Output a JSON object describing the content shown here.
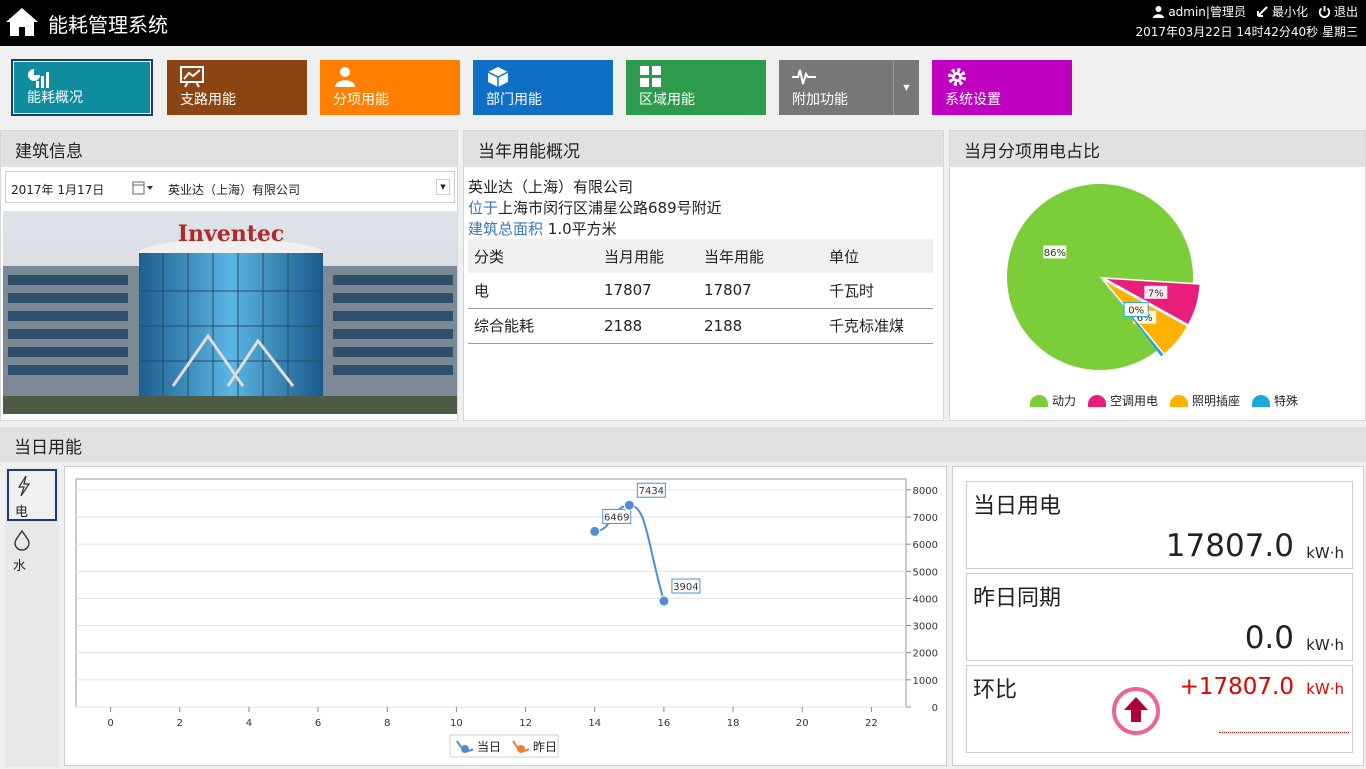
{
  "app": {
    "title": "能耗管理系统"
  },
  "user": {
    "name": "admin|管理员",
    "minimize": "最小化",
    "logout": "退出",
    "datetime": "2017年03月22日 14时42分40秒 星期三"
  },
  "nav": [
    {
      "label": "能耗概况",
      "color": "#0f8c9e",
      "icon": "overview-icon"
    },
    {
      "label": "支路用能",
      "color": "#8b4513",
      "icon": "branch-chart-icon"
    },
    {
      "label": "分项用能",
      "color": "#ff8000",
      "icon": "person-icon"
    },
    {
      "label": "部门用能",
      "color": "#0f6fc6",
      "icon": "cube-icon"
    },
    {
      "label": "区域用能",
      "color": "#2e9a4b",
      "icon": "grid-icon"
    },
    {
      "label": "附加功能",
      "color": "#777777",
      "icon": "pulse-icon"
    },
    {
      "label": "系统设置",
      "color": "#c000c0",
      "icon": "gear-icon"
    }
  ],
  "building": {
    "header": "建筑信息",
    "date": "2017年  1月17日",
    "company": "英业达（上海）有限公司",
    "sign": "Inventec"
  },
  "yearly": {
    "header": "当年用能概况",
    "company": "英业达（上海）有限公司",
    "location_label": "位于",
    "location": "上海市闵行区浦星公路689号附近",
    "area_label": "建筑总面积",
    "area": " 1.0平方米",
    "columns": [
      "分类",
      "当月用能",
      "当年用能",
      "单位"
    ],
    "rows": [
      [
        "电",
        "17807",
        "17807",
        "千瓦时"
      ],
      [
        "综合能耗",
        "2188",
        "2188",
        "千克标准煤"
      ]
    ]
  },
  "pie": {
    "header": "当月分项用电占比",
    "legend": [
      {
        "name": "动力",
        "color": "#7ccd3a"
      },
      {
        "name": "空调用电",
        "color": "#e91e7a"
      },
      {
        "name": "照明插座",
        "color": "#ffb300"
      },
      {
        "name": "特殊",
        "color": "#1aa8d8"
      }
    ],
    "labels": [
      "86%",
      "7%",
      "6%",
      "0%"
    ]
  },
  "daily": {
    "header": "当日用能",
    "tabs": [
      {
        "label": "电",
        "icon": "lightning-icon"
      },
      {
        "label": "水",
        "icon": "drop-icon"
      }
    ],
    "legend": [
      "当日",
      "昨日"
    ],
    "kpis": [
      {
        "title": "当日用电",
        "value": "17807.0",
        "unit": "kW·h"
      },
      {
        "title": "昨日同期",
        "value": "0.0",
        "unit": "kW·h"
      },
      {
        "title": "环比",
        "value": "+17807.0",
        "unit": "kW·h",
        "color": "#e00000"
      }
    ]
  },
  "chart_data": [
    {
      "type": "pie",
      "categories": [
        "动力",
        "空调用电",
        "照明插座",
        "特殊"
      ],
      "values": [
        86,
        7,
        6,
        0.5
      ],
      "labels": [
        "86%",
        "7%",
        "6%",
        "0%"
      ]
    },
    {
      "type": "line",
      "x": [
        14,
        15,
        16
      ],
      "series": [
        {
          "name": "当日",
          "values": [
            6469,
            7434,
            3904
          ],
          "color": "#4f8fd0"
        },
        {
          "name": "昨日",
          "values": [],
          "color": "#f08030"
        }
      ],
      "xticks": [
        0,
        2,
        4,
        6,
        8,
        10,
        12,
        14,
        16,
        18,
        20,
        22
      ],
      "yticks": [
        0,
        1000,
        2000,
        3000,
        4000,
        5000,
        6000,
        7000,
        8000
      ],
      "xlim": [
        -1,
        23
      ],
      "ylim": [
        0,
        8400
      ],
      "grid": true,
      "legend_position": "bottom"
    }
  ]
}
